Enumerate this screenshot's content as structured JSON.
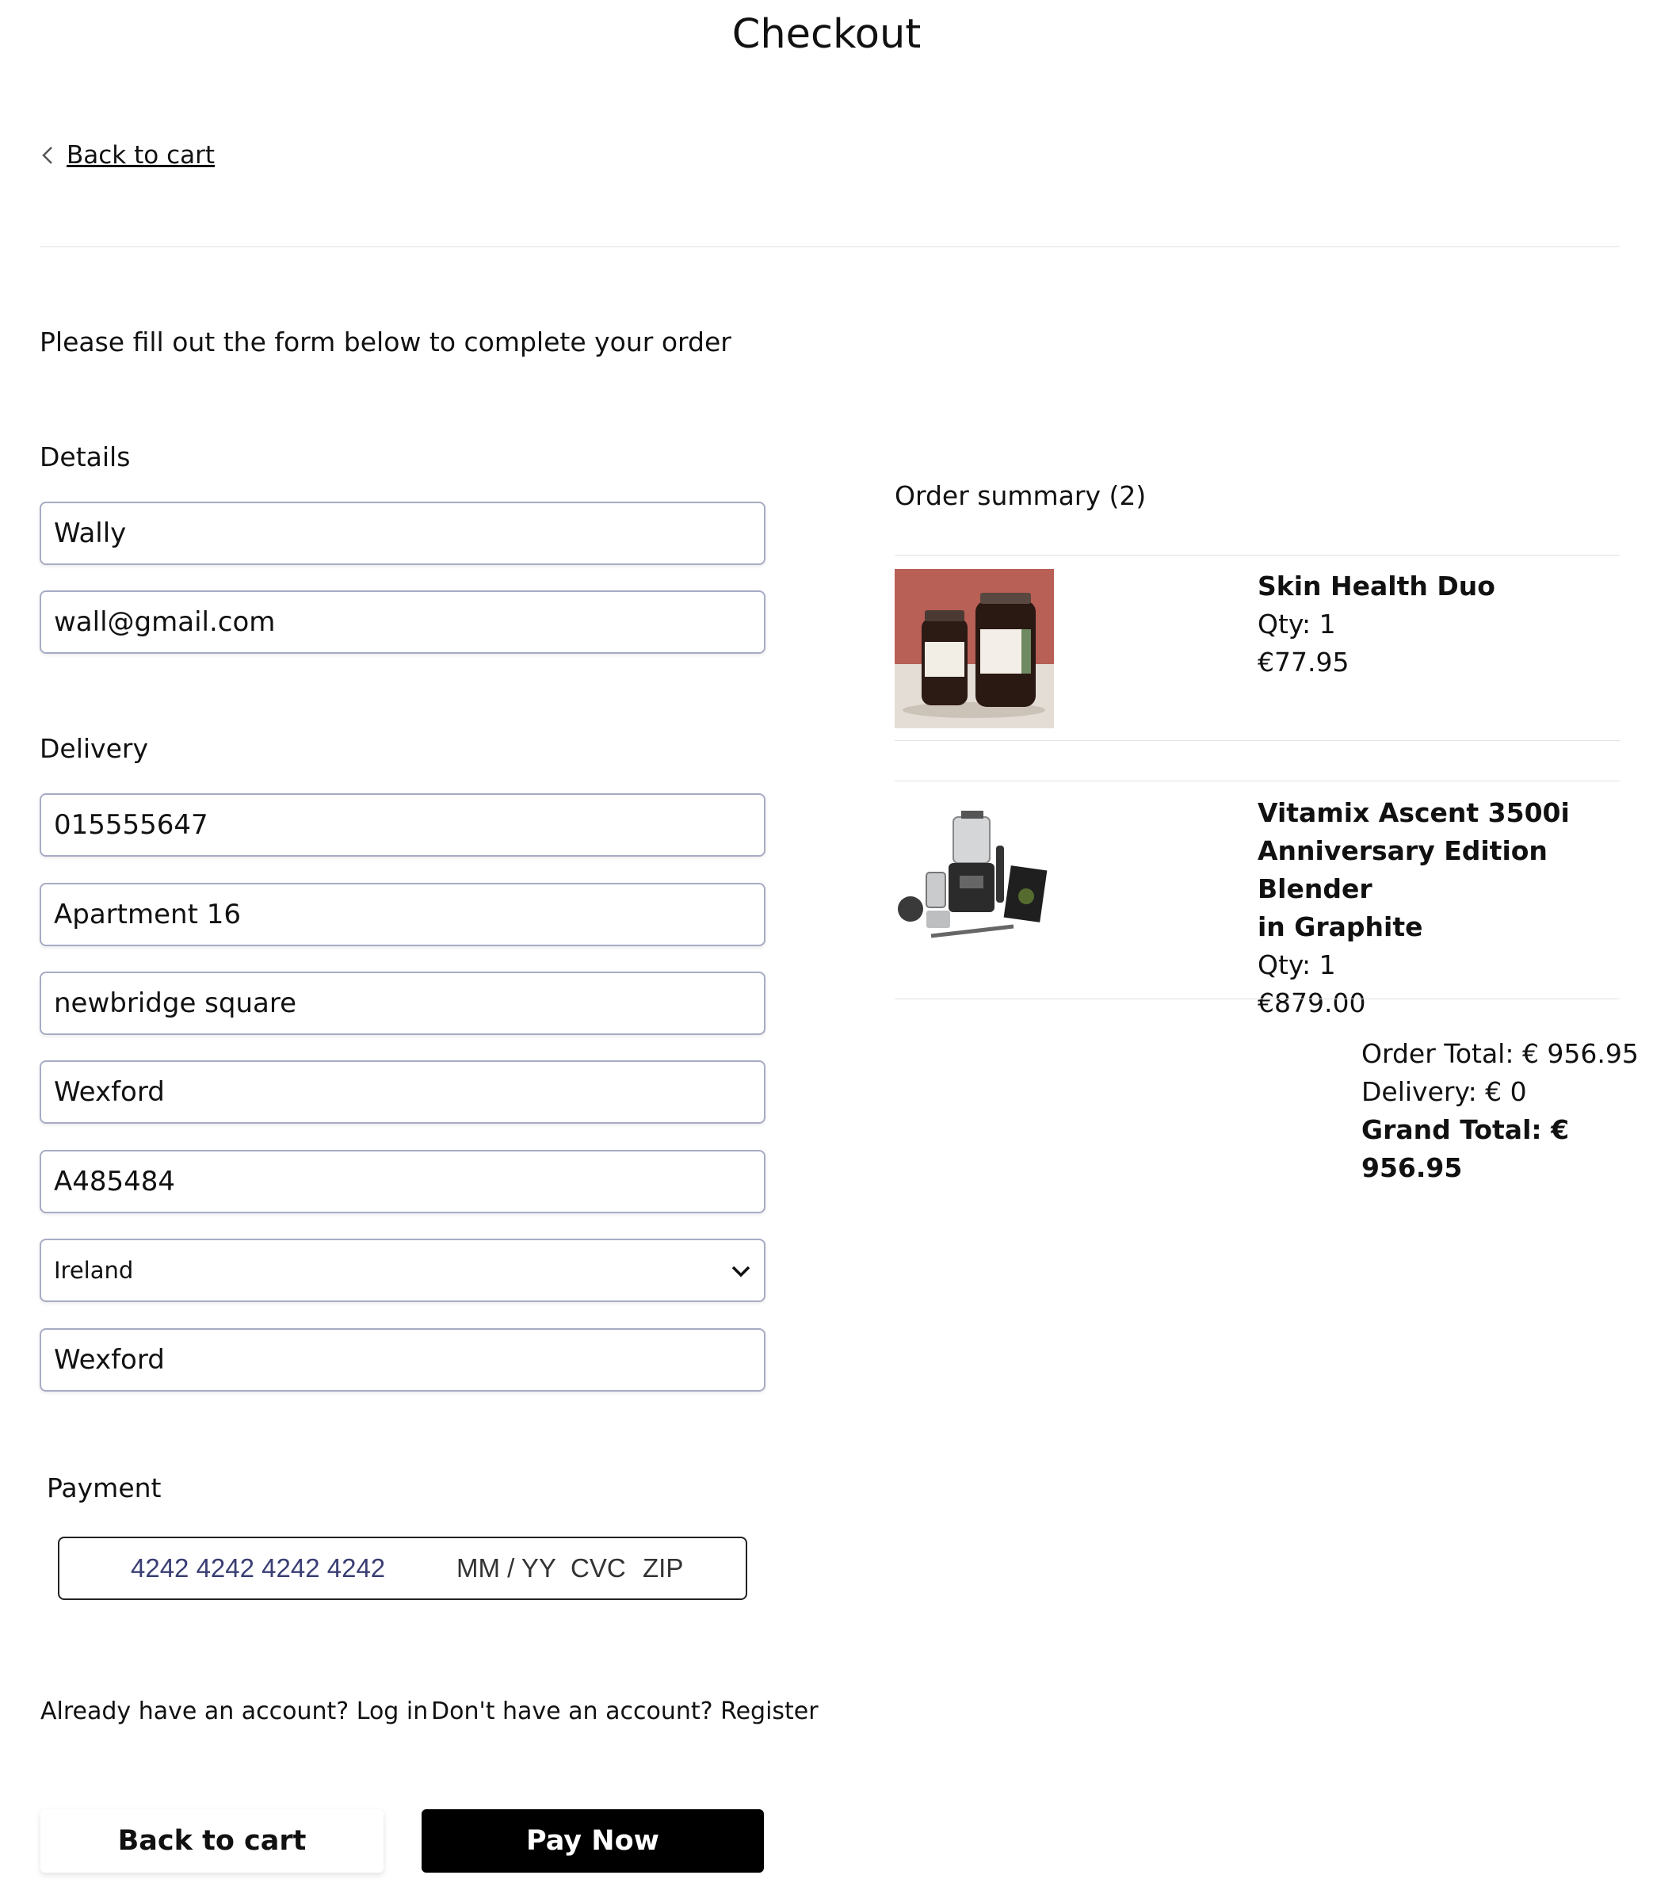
{
  "page": {
    "title": "Checkout"
  },
  "nav": {
    "back_link": "Back to cart"
  },
  "intro": "Please fill out the form below to complete your order",
  "details": {
    "label": "Details",
    "name": "Wally",
    "email": "wall@gmail.com"
  },
  "delivery": {
    "label": "Delivery",
    "phone": "015555647",
    "address1": "Apartment 16",
    "address2": "newbridge square",
    "city": "Wexford",
    "postcode": "A485484",
    "country": "Ireland",
    "county": "Wexford"
  },
  "payment": {
    "label": "Payment",
    "card_number": "4242 4242 4242 4242",
    "expiry_placeholder": "MM / YY",
    "cvc_placeholder": "CVC",
    "zip_placeholder": "ZIP"
  },
  "account": {
    "login": "Already have an account? Log in",
    "register": "Don't have an account? Register"
  },
  "buttons": {
    "back": "Back to cart",
    "pay": "Pay Now"
  },
  "summary": {
    "title": "Order summary (2)",
    "items": [
      {
        "name": "Skin Health Duo",
        "qty": "Qty: 1",
        "price": "€77.95"
      },
      {
        "name_lines": [
          "Vitamix Ascent 3500i",
          "Anniversary Edition Blender",
          "in Graphite"
        ],
        "qty": "Qty: 1",
        "price": "€879.00"
      }
    ],
    "order_total": "Order Total: € 956.95",
    "delivery": "Delivery: € 0",
    "grand_total": "Grand Total: € 956.95"
  },
  "icons": {
    "back": "chevron-left-icon",
    "select": "chevron-down-icon"
  }
}
